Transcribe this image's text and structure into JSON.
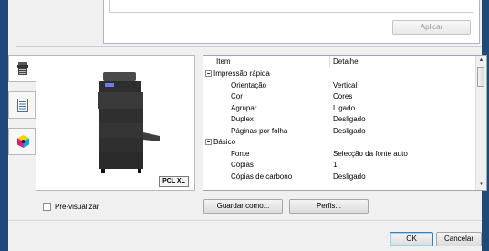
{
  "top_panel": {
    "apply_label": "Aplicar"
  },
  "preview": {
    "pcl_label": "PCL XL",
    "preview_label": "Pré-visualizar"
  },
  "grid": {
    "header_item": "Item",
    "header_detail": "Detalhe",
    "rows": [
      {
        "kind": "group",
        "label": "Impressão rápida",
        "value": ""
      },
      {
        "kind": "child",
        "label": "Orientação",
        "value": "Vertical"
      },
      {
        "kind": "child",
        "label": "Cor",
        "value": "Cores"
      },
      {
        "kind": "child",
        "label": "Agrupar",
        "value": "Ligado"
      },
      {
        "kind": "child",
        "label": "Duplex",
        "value": "Desligado"
      },
      {
        "kind": "child",
        "label": "Páginas por folha",
        "value": "Desligado"
      },
      {
        "kind": "group",
        "label": "Básico",
        "value": ""
      },
      {
        "kind": "child",
        "label": "Fonte",
        "value": "Selecção da fonte auto"
      },
      {
        "kind": "child",
        "label": "Cópias",
        "value": "1"
      },
      {
        "kind": "child",
        "label": "Cópias de carbono",
        "value": "Desligado"
      }
    ]
  },
  "buttons": {
    "save": "Guardar como...",
    "profiles": "Perfis...",
    "ok": "OK",
    "cancel": "Cancelar"
  },
  "colors": {
    "frame": "#1d4a78",
    "default_button_border": "#3c7fb1"
  },
  "icons": {
    "tab1": "printer-device-icon",
    "tab2": "document-list-icon",
    "tab3": "color-cube-icon",
    "expander": "collapse-minus-icon"
  }
}
